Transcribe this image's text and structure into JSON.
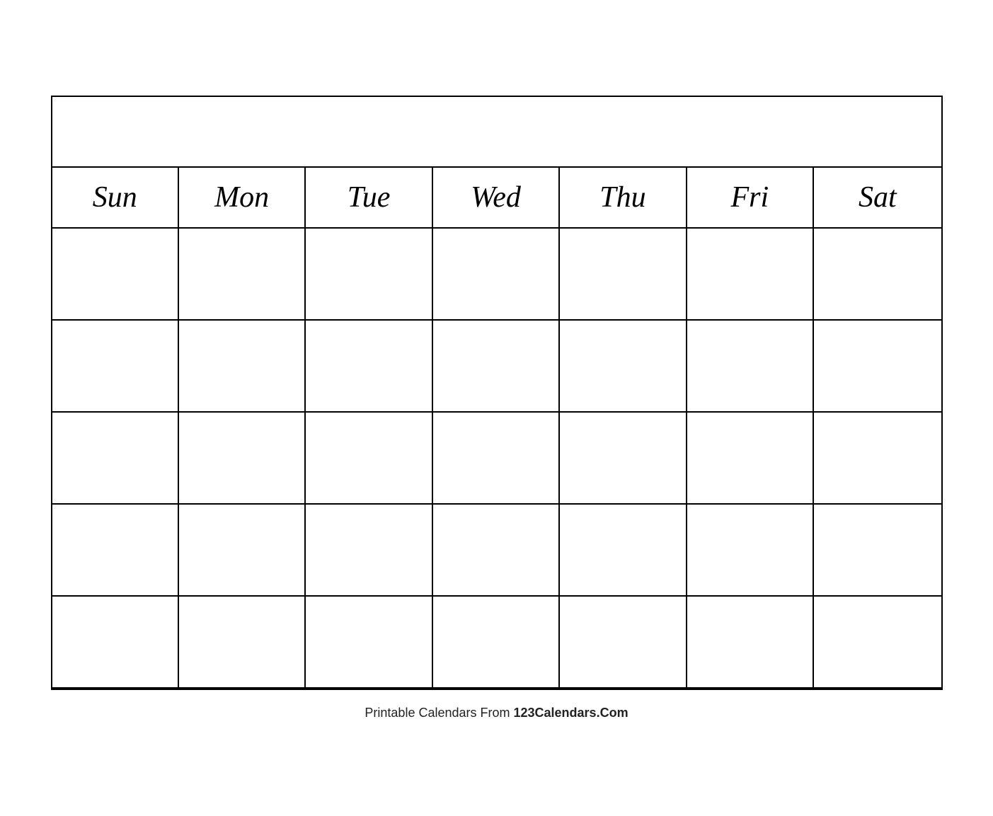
{
  "calendar": {
    "days": [
      "Sun",
      "Mon",
      "Tue",
      "Wed",
      "Thu",
      "Fri",
      "Sat"
    ],
    "rows": 5,
    "cols": 7
  },
  "footer": {
    "prefix": "Printable Calendars From ",
    "brand": "123Calendars.Com"
  }
}
